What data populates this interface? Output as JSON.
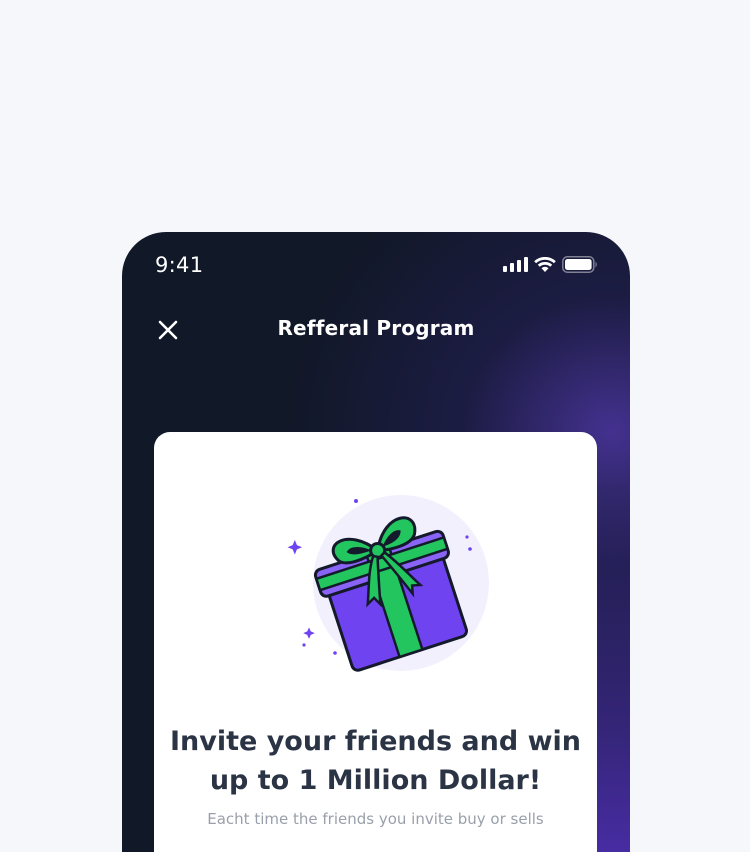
{
  "status_bar": {
    "time": "9:41",
    "icons": [
      "cellular-signal-icon",
      "wifi-icon",
      "battery-icon"
    ]
  },
  "nav": {
    "close_icon": "close-icon",
    "title": "Refferal Program"
  },
  "card": {
    "illustration": "gift-box-icon",
    "headline_line1": "Invite your friends and win",
    "headline_line2": "up to 1 Million Dollar!",
    "subtext": "Eacht time the friends you invite buy or sells"
  },
  "colors": {
    "background": "#111827",
    "accent_purple": "#7043f0",
    "ribbon_green": "#22c55e",
    "card": "#ffffff",
    "headline": "#2b3445"
  }
}
